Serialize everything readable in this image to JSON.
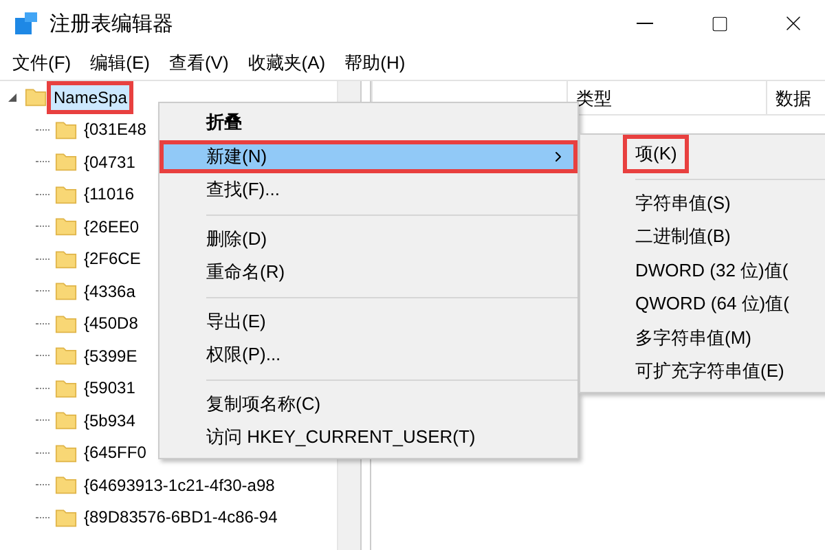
{
  "window": {
    "title": "注册表编辑器"
  },
  "menu_bar": [
    "文件(F)",
    "编辑(E)",
    "查看(V)",
    "收藏夹(A)",
    "帮助(H)"
  ],
  "tree": {
    "label": "NameSpa",
    "selected": true,
    "highlighted": true,
    "expanded": true,
    "children": [
      {
        "label": "{031E48",
        "selected": false
      },
      {
        "label": "{04731",
        "selected": false
      },
      {
        "label": "{11016",
        "selected": false
      },
      {
        "label": "{26EE0",
        "selected": false
      },
      {
        "label": "{2F6CE",
        "selected": false
      },
      {
        "label": "{4336a",
        "selected": false
      },
      {
        "label": "{450D8",
        "selected": false
      },
      {
        "label": "{5399E",
        "selected": false
      },
      {
        "label": "{59031",
        "selected": false
      },
      {
        "label": "{5b934",
        "selected": false
      },
      {
        "label": "{645FF0",
        "selected": false
      },
      {
        "label": "{64693913-1c21-4f30-a98",
        "selected": false
      },
      {
        "label": "{89D83576-6BD1-4c86-94",
        "selected": false
      }
    ]
  },
  "list_columns": [
    "类型",
    "数据"
  ],
  "context_menu": [
    {
      "kind": "item",
      "label": "折叠",
      "bold": true,
      "selected": false,
      "highlighted": false,
      "submenu": false
    },
    {
      "kind": "item",
      "label": "新建(N)",
      "bold": false,
      "selected": true,
      "highlighted": true,
      "submenu": true
    },
    {
      "kind": "item",
      "label": "查找(F)...",
      "bold": false,
      "selected": false,
      "highlighted": false,
      "submenu": false
    },
    {
      "kind": "separator"
    },
    {
      "kind": "item",
      "label": "删除(D)",
      "bold": false,
      "selected": false,
      "highlighted": false,
      "submenu": false
    },
    {
      "kind": "item",
      "label": "重命名(R)",
      "bold": false,
      "selected": false,
      "highlighted": false,
      "submenu": false
    },
    {
      "kind": "separator"
    },
    {
      "kind": "item",
      "label": "导出(E)",
      "bold": false,
      "selected": false,
      "highlighted": false,
      "submenu": false
    },
    {
      "kind": "item",
      "label": "权限(P)...",
      "bold": false,
      "selected": false,
      "highlighted": false,
      "submenu": false
    },
    {
      "kind": "separator"
    },
    {
      "kind": "item",
      "label": "复制项名称(C)",
      "bold": false,
      "selected": false,
      "highlighted": false,
      "submenu": false
    },
    {
      "kind": "item",
      "label": "访问 HKEY_CURRENT_USER(T)",
      "bold": false,
      "selected": false,
      "highlighted": false,
      "submenu": false
    }
  ],
  "submenu": [
    {
      "kind": "item",
      "label": "项(K)",
      "highlighted": true
    },
    {
      "kind": "separator"
    },
    {
      "kind": "item",
      "label": "字符串值(S)",
      "highlighted": false
    },
    {
      "kind": "item",
      "label": "二进制值(B)",
      "highlighted": false
    },
    {
      "kind": "item",
      "label": "DWORD (32 位)值(",
      "highlighted": false
    },
    {
      "kind": "item",
      "label": "QWORD (64 位)值(",
      "highlighted": false
    },
    {
      "kind": "item",
      "label": "多字符串值(M)",
      "highlighted": false
    },
    {
      "kind": "item",
      "label": "可扩充字符串值(E)",
      "highlighted": false
    }
  ]
}
